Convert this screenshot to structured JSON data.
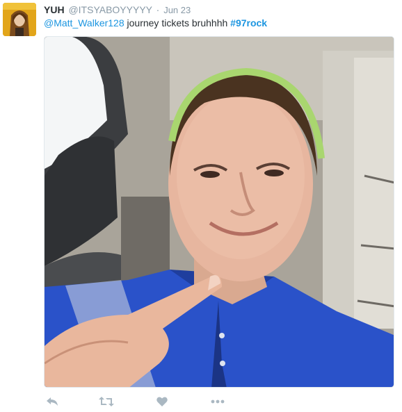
{
  "tweet": {
    "author": {
      "fullname": "YUH",
      "screen_name": "@ITSYABOYYYYY",
      "avatar_icon": "user-avatar"
    },
    "separator": "·",
    "timestamp": "Jun 23",
    "text": {
      "mention": "@Matt_Walker128",
      "body": " journey tickets bruhhhh ",
      "hashtag": "#97rock"
    },
    "media": {
      "kind": "photo",
      "icon": "selfie-photo"
    },
    "actions": [
      {
        "name": "reply",
        "icon": "reply-icon"
      },
      {
        "name": "retweet",
        "icon": "retweet-icon"
      },
      {
        "name": "like",
        "icon": "heart-icon"
      },
      {
        "name": "more",
        "icon": "more-icon"
      }
    ],
    "colors": {
      "link": "#1b95e0",
      "muted": "#8899a6",
      "text": "#292f33",
      "action_icon": "#aab8c2"
    }
  }
}
